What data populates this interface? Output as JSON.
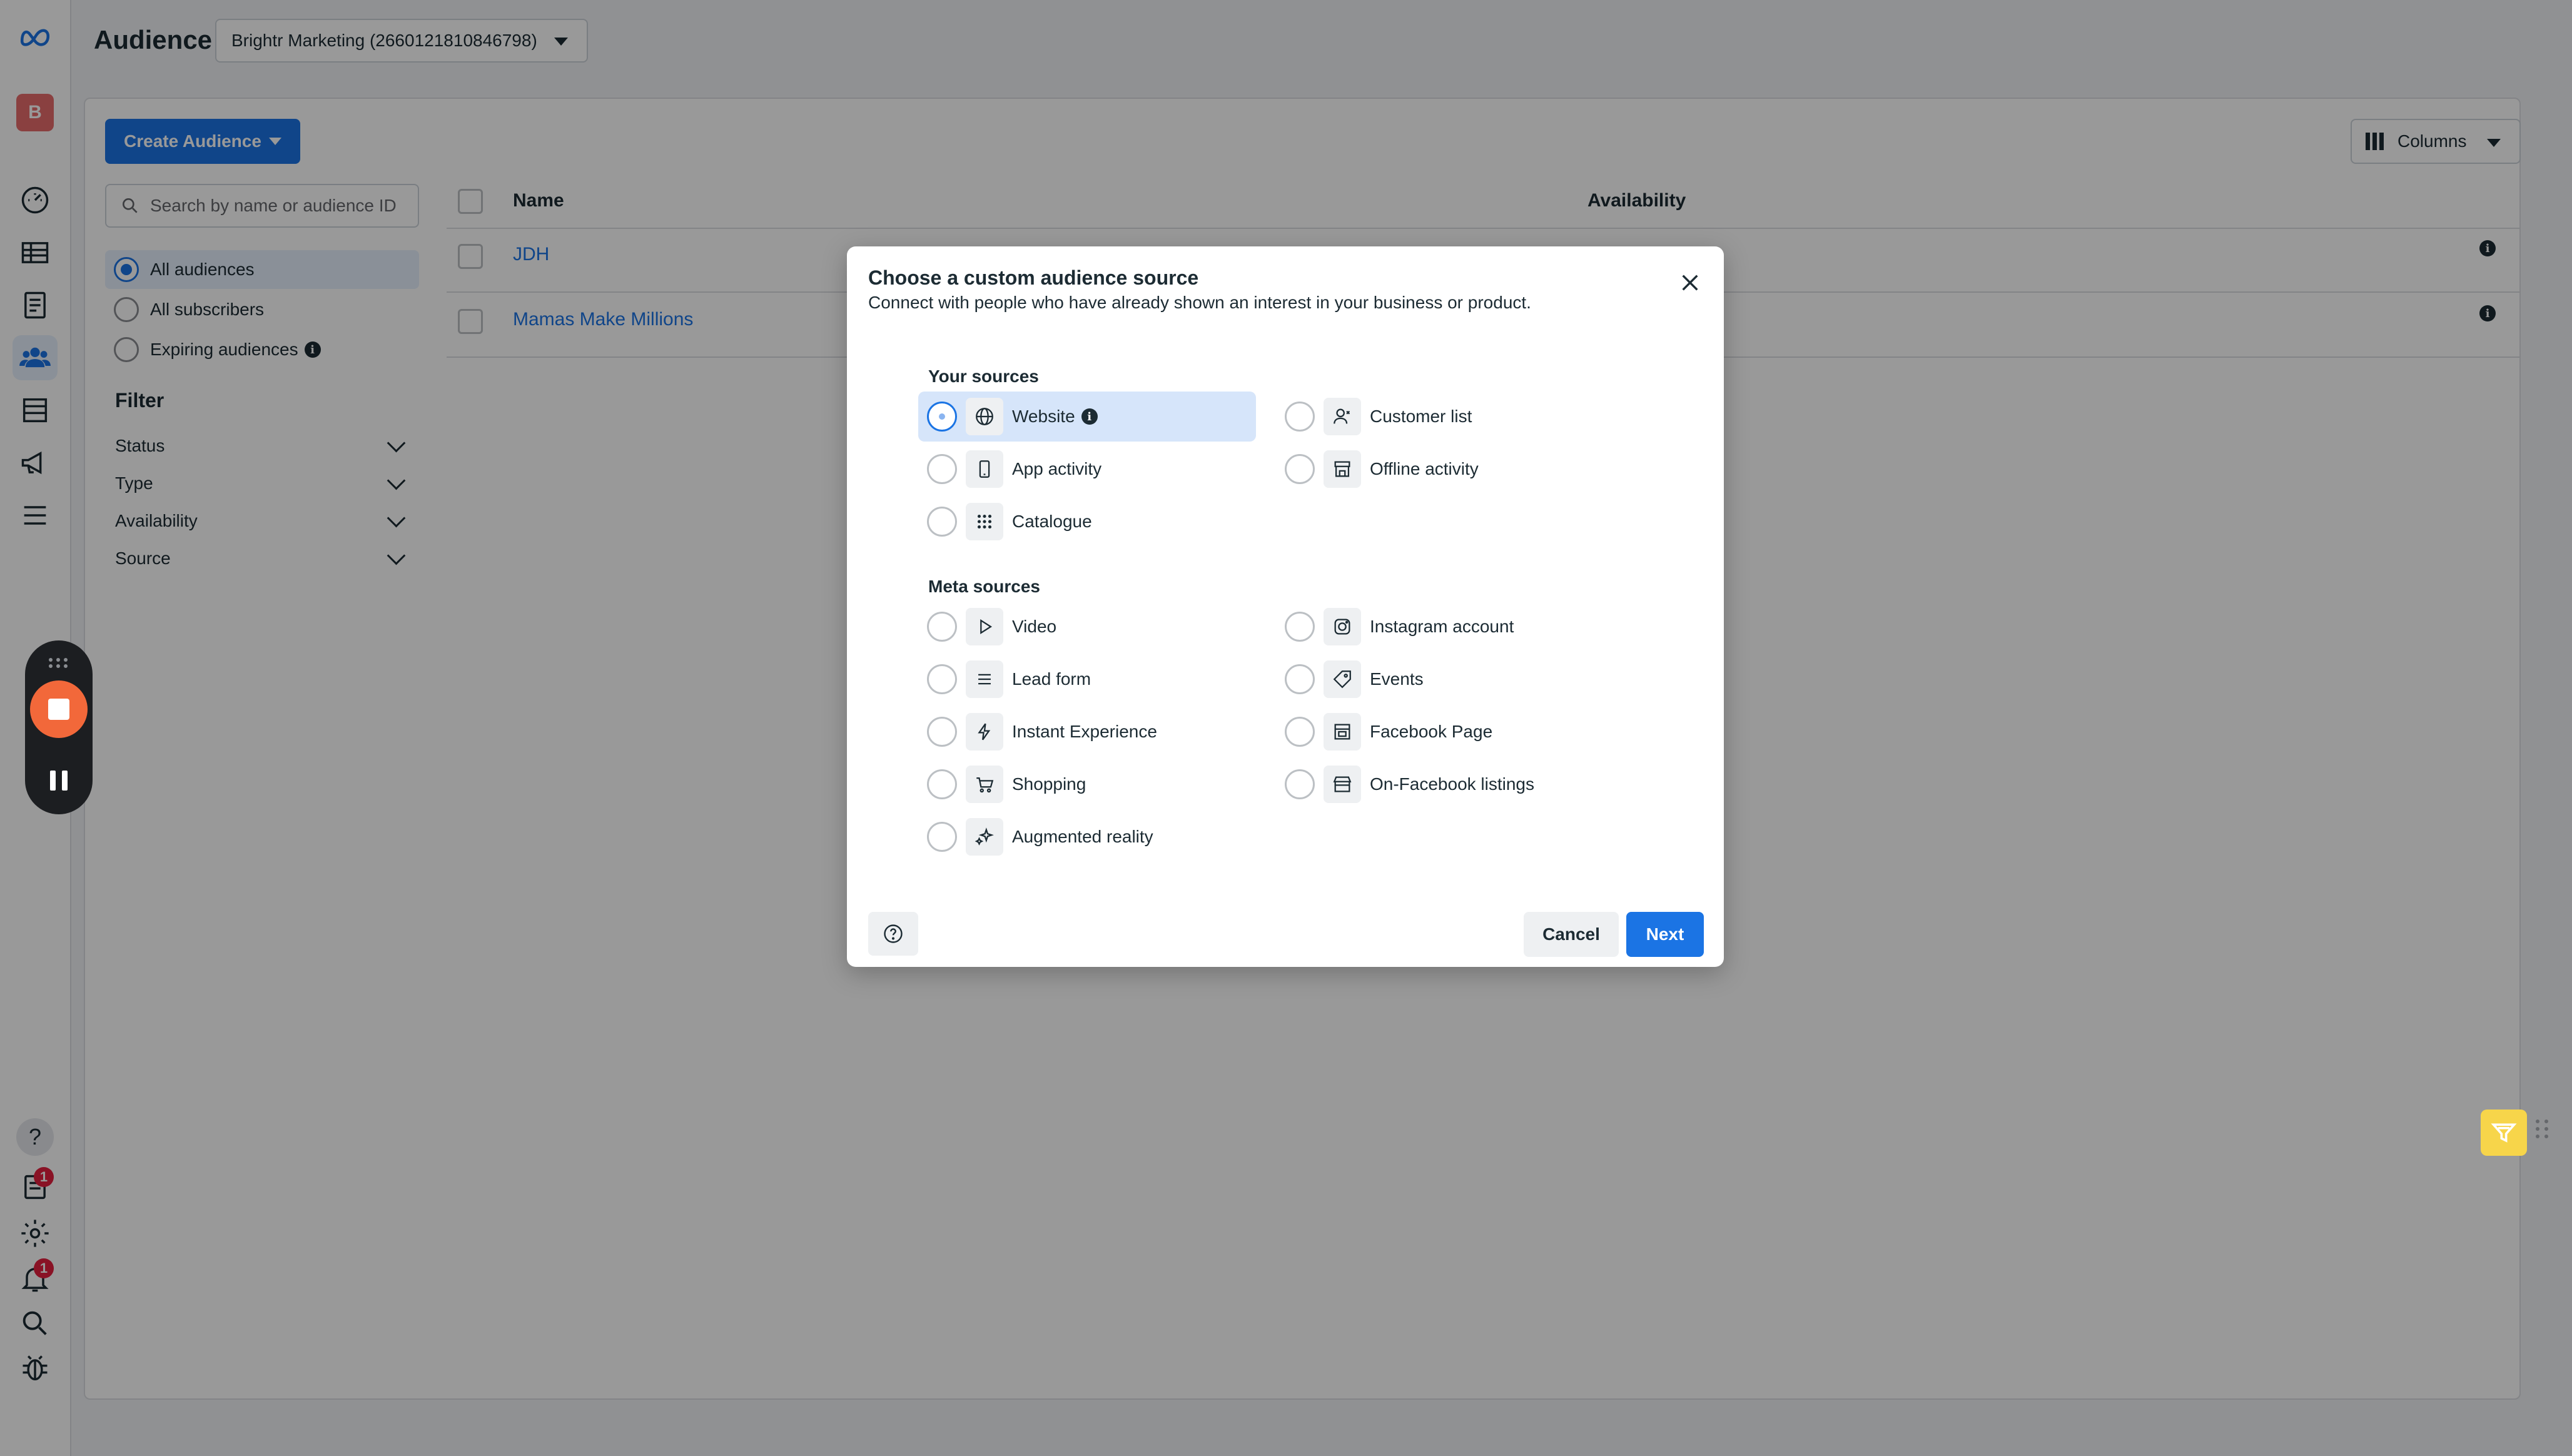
{
  "nav": {
    "account_initial": "B",
    "badges": {
      "pages": "1",
      "notifications": "1"
    }
  },
  "header": {
    "title": "Audience",
    "account_selector": "Brightr Marketing (2660121810846798)"
  },
  "toolbar": {
    "create_label": "Create Audience",
    "columns_label": "Columns"
  },
  "sidebar": {
    "search_placeholder": "Search by name or audience ID",
    "views": [
      {
        "label": "All audiences",
        "selected": true
      },
      {
        "label": "All subscribers",
        "selected": false
      },
      {
        "label": "Expiring audiences",
        "selected": false
      }
    ],
    "filter_heading": "Filter",
    "filters": [
      "Status",
      "Type",
      "Availability",
      "Source"
    ]
  },
  "table": {
    "columns": {
      "name": "Name",
      "availability": "Availability"
    },
    "rows": [
      {
        "name": "JDH"
      },
      {
        "name": "Mamas Make Millions"
      }
    ]
  },
  "dialog": {
    "title": "Choose a custom audience source",
    "subtitle": "Connect with people who have already shown an interest in your business or product.",
    "your_sources_title": "Your sources",
    "your_sources": [
      {
        "label": "Website",
        "icon": "globe-icon",
        "selected": true
      },
      {
        "label": "Customer list",
        "icon": "person-icon"
      },
      {
        "label": "App activity",
        "icon": "phone-icon"
      },
      {
        "label": "Offline activity",
        "icon": "store-icon"
      },
      {
        "label": "Catalogue",
        "icon": "grid-icon"
      }
    ],
    "meta_sources_title": "Meta sources",
    "meta_sources": [
      {
        "label": "Video",
        "icon": "play-icon"
      },
      {
        "label": "Instagram account",
        "icon": "instagram-icon"
      },
      {
        "label": "Lead form",
        "icon": "list-icon"
      },
      {
        "label": "Events",
        "icon": "tag-icon"
      },
      {
        "label": "Instant Experience",
        "icon": "bolt-icon"
      },
      {
        "label": "Facebook Page",
        "icon": "page-icon"
      },
      {
        "label": "Shopping",
        "icon": "cart-icon"
      },
      {
        "label": "On-Facebook listings",
        "icon": "storefront-icon"
      },
      {
        "label": "Augmented reality",
        "icon": "sparkle-icon"
      }
    ],
    "cancel_label": "Cancel",
    "next_label": "Next"
  },
  "colors": {
    "accent": "#1b74e4",
    "selected_bg": "#d6e5fa",
    "recorder_stop": "#f2683a",
    "feedback": "#f7d54a"
  }
}
